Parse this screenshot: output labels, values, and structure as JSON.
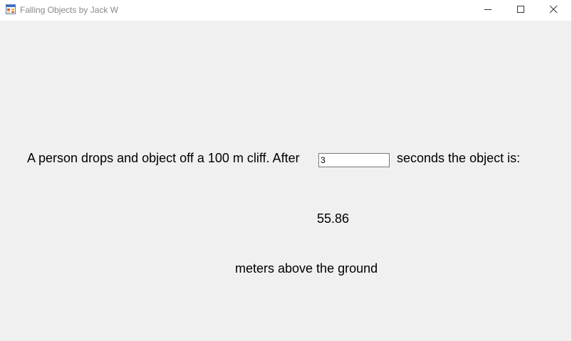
{
  "window": {
    "title": "Falling Objects by Jack W"
  },
  "form": {
    "prompt_before": "A person drops and object off a 100 m cliff. After",
    "seconds_value": "3",
    "prompt_after": "seconds the object is:",
    "result_value": "55.86",
    "result_unit": "meters above the ground"
  },
  "icons": {
    "app": "form-icon",
    "minimize": "minimize-icon",
    "maximize": "maximize-icon",
    "close": "close-icon"
  },
  "colors": {
    "window_bg": "#f0f0f0",
    "titlebar_bg": "#ffffff",
    "title_text": "#8a8a8a"
  }
}
